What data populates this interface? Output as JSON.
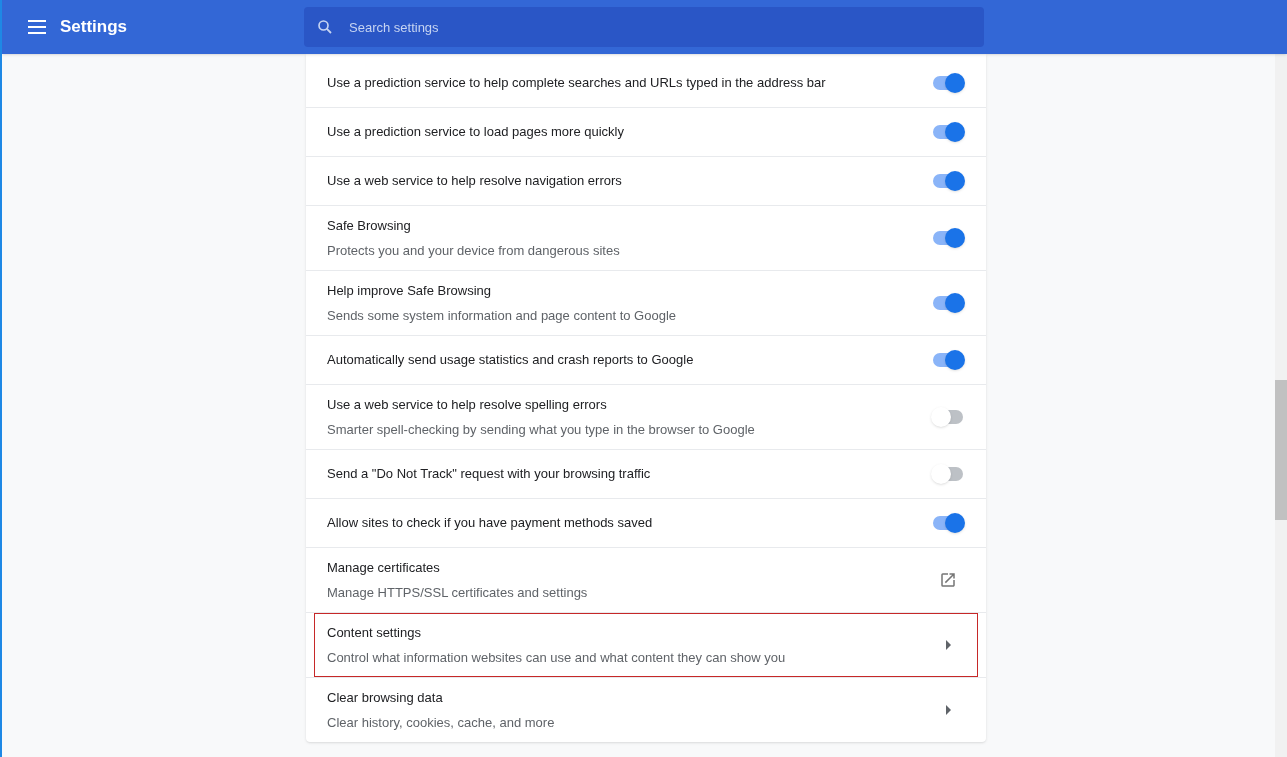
{
  "header": {
    "title": "Settings",
    "search": {
      "placeholder": "Search settings"
    }
  },
  "rows": [
    {
      "kind": "toggle",
      "title": "Use a prediction service to help complete searches and URLs typed in the address bar",
      "on": true,
      "highlighted": false
    },
    {
      "kind": "toggle",
      "title": "Use a prediction service to load pages more quickly",
      "on": true,
      "highlighted": false
    },
    {
      "kind": "toggle",
      "title": "Use a web service to help resolve navigation errors",
      "on": true,
      "highlighted": false
    },
    {
      "kind": "toggle",
      "title": "Safe Browsing",
      "subtitle": "Protects you and your device from dangerous sites",
      "on": true,
      "highlighted": false
    },
    {
      "kind": "toggle",
      "title": "Help improve Safe Browsing",
      "subtitle": "Sends some system information and page content to Google",
      "on": true,
      "highlighted": false
    },
    {
      "kind": "toggle",
      "title": "Automatically send usage statistics and crash reports to Google",
      "on": true,
      "highlighted": false
    },
    {
      "kind": "toggle",
      "title": "Use a web service to help resolve spelling errors",
      "subtitle": "Smarter spell-checking by sending what you type in the browser to Google",
      "on": false,
      "highlighted": false
    },
    {
      "kind": "toggle",
      "title": "Send a \"Do Not Track\" request with your browsing traffic",
      "on": false,
      "highlighted": false
    },
    {
      "kind": "toggle",
      "title": "Allow sites to check if you have payment methods saved",
      "on": true,
      "highlighted": false
    },
    {
      "kind": "external",
      "title": "Manage certificates",
      "subtitle": "Manage HTTPS/SSL certificates and settings",
      "highlighted": false
    },
    {
      "kind": "arrow",
      "title": "Content settings",
      "subtitle": "Control what information websites can use and what content they can show you",
      "highlighted": true
    },
    {
      "kind": "arrow",
      "title": "Clear browsing data",
      "subtitle": "Clear history, cookies, cache, and more",
      "highlighted": false
    }
  ]
}
